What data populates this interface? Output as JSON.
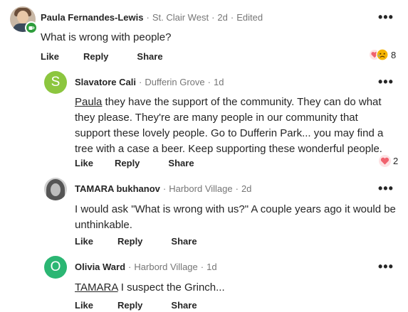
{
  "comments": [
    {
      "author": "Paula Fernandes-Lewis",
      "location": "St. Clair West",
      "time": "2d",
      "edited": "Edited",
      "text": "What is wrong with people?",
      "actions": {
        "like": "Like",
        "reply": "Reply",
        "share": "Share"
      },
      "reaction_count": "8"
    },
    {
      "author": "Slavatore Cali",
      "avatar_letter": "S",
      "avatar_color": "#8cc63f",
      "location": "Dufferin Grove",
      "time": "1d",
      "mention": "Paula",
      "text": " they have the support of the community.  They can do what they please. They're are many people in our community that support these lovely people. Go to Dufferin Park... you may find a tree with a case a beer. Keep supporting these wonderful people.",
      "actions": {
        "like": "Like",
        "reply": "Reply",
        "share": "Share"
      },
      "reaction_count": "2"
    },
    {
      "author": "TAMARA bukhanov",
      "location": "Harbord Village",
      "time": "2d",
      "text": "I would ask \"What is wrong with us?\" A couple years ago it would be unthinkable.",
      "actions": {
        "like": "Like",
        "reply": "Reply",
        "share": "Share"
      }
    },
    {
      "author": "Olivia Ward",
      "avatar_letter": "O",
      "avatar_color": "#2bb673",
      "location": "Harbord Village",
      "time": "1d",
      "mention": "TAMARA",
      "text": " I suspect the Grinch...",
      "actions": {
        "like": "Like",
        "reply": "Reply",
        "share": "Share"
      }
    }
  ],
  "more_label": "•••",
  "icons": {
    "more": "more-options-icon",
    "badge": "coffee-badge-icon",
    "reactions": [
      "heart-icon",
      "sad-face-icon"
    ]
  },
  "colors": {
    "heart": "#f0626e",
    "sad": "#f5b400",
    "badge": "#2e9d3c",
    "meta": "#767676"
  }
}
